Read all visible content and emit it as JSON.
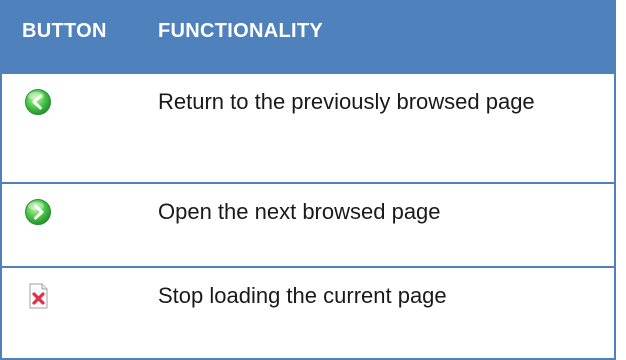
{
  "header": {
    "col_button": "BUTTON",
    "col_functionality": "FUNCTIONALITY"
  },
  "rows": [
    {
      "icon": "back-arrow-green-circle-icon",
      "description": "Return to the previously browsed page"
    },
    {
      "icon": "forward-arrow-green-circle-icon",
      "description": "Open the next browsed page"
    },
    {
      "icon": "stop-red-x-document-icon",
      "description": "Stop loading the current page"
    }
  ],
  "colors": {
    "header_bg": "#4f81bd",
    "header_text": "#ffffff",
    "border": "#4f81bd",
    "icon_green": "#3fbf3f",
    "icon_red": "#e0304a"
  }
}
